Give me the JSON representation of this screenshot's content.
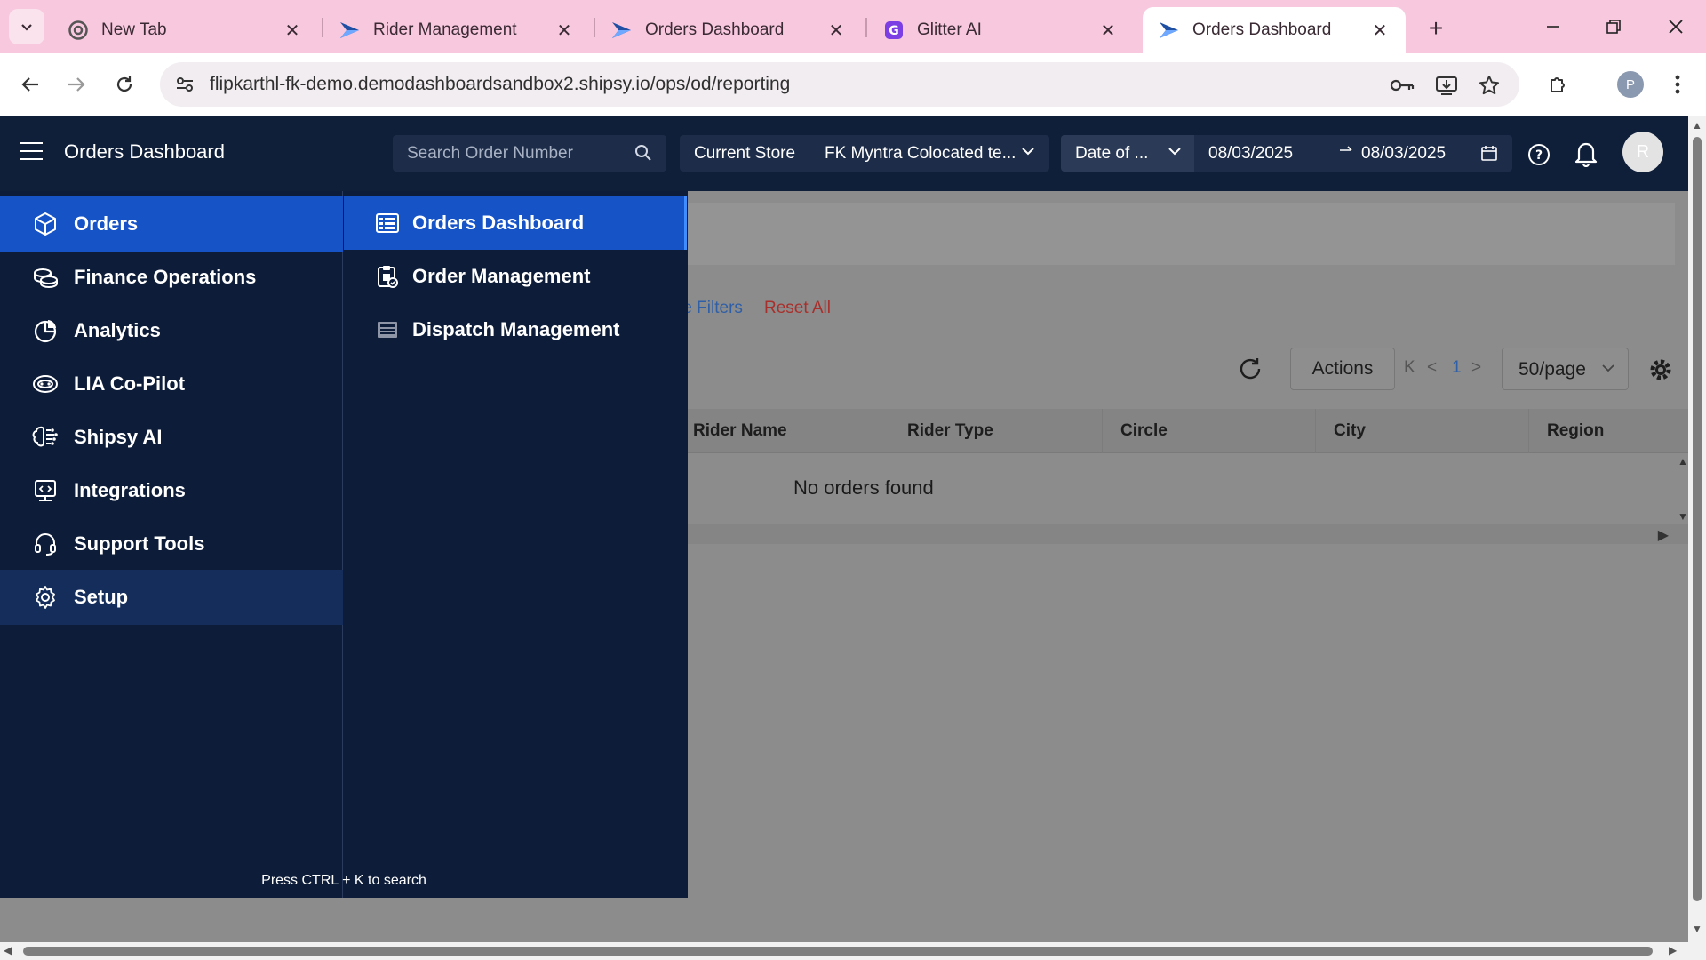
{
  "browser": {
    "tabs": [
      {
        "title": "New Tab",
        "icon": "chrome-icon"
      },
      {
        "title": "Rider Management",
        "icon": "shipsy-logo-icon"
      },
      {
        "title": "Orders Dashboard",
        "icon": "shipsy-logo-icon"
      },
      {
        "title": "Glitter AI",
        "icon": "glitter-logo-icon"
      },
      {
        "title": "Orders Dashboard",
        "icon": "shipsy-logo-icon",
        "active": true
      }
    ],
    "url": "flipkarthl-fk-demo.demodashboardsandbox2.shipsy.io/ops/od/reporting",
    "profile_initial": "P"
  },
  "header": {
    "title": "Orders Dashboard",
    "search_placeholder": "Search Order Number",
    "store_label": "Current Store",
    "store_value": "FK Myntra Colocated te...",
    "date_type": "Date of ...",
    "date_from": "08/03/2025",
    "date_to": "08/03/2025",
    "user_initial": "R"
  },
  "menu": {
    "items": [
      {
        "label": "Orders",
        "icon": "orders-box-icon"
      },
      {
        "label": "Finance Operations",
        "icon": "finance-coins-icon"
      },
      {
        "label": "Analytics",
        "icon": "analytics-pie-icon"
      },
      {
        "label": "LIA Co-Pilot",
        "icon": "copilot-icon"
      },
      {
        "label": "Shipsy AI",
        "icon": "ai-brain-icon"
      },
      {
        "label": "Integrations",
        "icon": "integrations-icon"
      },
      {
        "label": "Support Tools",
        "icon": "headset-icon"
      },
      {
        "label": "Setup",
        "icon": "gear-icon"
      }
    ],
    "submenu": [
      {
        "label": "Orders Dashboard",
        "icon": "dashboard-list-icon"
      },
      {
        "label": "Order Management",
        "icon": "order-management-icon"
      },
      {
        "label": "Dispatch Management",
        "icon": "dispatch-icon"
      }
    ],
    "hint": "Press CTRL + K to search"
  },
  "page": {
    "more_filters": "re Filters",
    "reset_all": "Reset All",
    "actions_label": "Actions",
    "page_number": "1",
    "per_page": "50/page",
    "columns": [
      "Rider Name",
      "Rider Type",
      "Circle",
      "City",
      "Region"
    ],
    "empty_message": "No orders found"
  },
  "colors": {
    "tabbar": "#f8c8df",
    "app_header": "#0f1e39",
    "menu_bg": "#0d1c38",
    "selected": "#1553c7",
    "link_blue": "#2f5fa7",
    "reset_red": "#a8302c"
  }
}
